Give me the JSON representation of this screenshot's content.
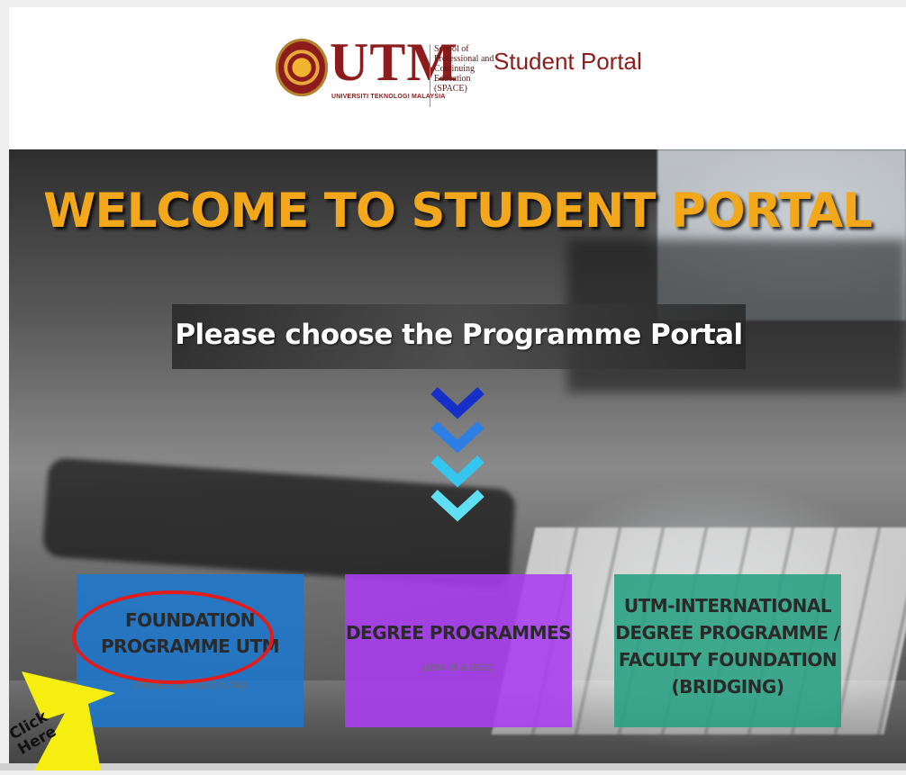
{
  "header": {
    "logo_text": "UTM",
    "logo_sub": "UNIVERSITI TEKNOLOGI MALAYSIA",
    "school_lines": [
      "School of",
      "Professional and",
      "Continuing",
      "Education",
      "(SPACE)"
    ],
    "portal_title": "Student Portal"
  },
  "hero": {
    "welcome": "WELCOME TO STUDENT PORTAL",
    "choose": "Please choose the Programme Portal",
    "chevron_colors": [
      "#1530c8",
      "#2d7fe6",
      "#34c6ee",
      "#5fe0f2"
    ]
  },
  "cards": [
    {
      "line1": "FOUNDATION",
      "line2": "PROGRAMME UTM",
      "sub": "(PROGRAM ASASI UTM)",
      "color": "#1e78cd"
    },
    {
      "line1": "DEGREE PROGRAMMES",
      "sub": "(BBA IB & BGS)",
      "color": "#aa3cf0"
    },
    {
      "line1": "UTM-INTERNATIONAL",
      "line2": "DEGREE PROGRAMME /",
      "line3": "FACULTY FOUNDATION",
      "line4": "(BRIDGING)",
      "color": "#28a082"
    }
  ],
  "annotation": {
    "click_line1": "Click",
    "click_line2": "Here",
    "highlight_color": "#e21b1b",
    "arrow_color": "#f7ee11"
  }
}
